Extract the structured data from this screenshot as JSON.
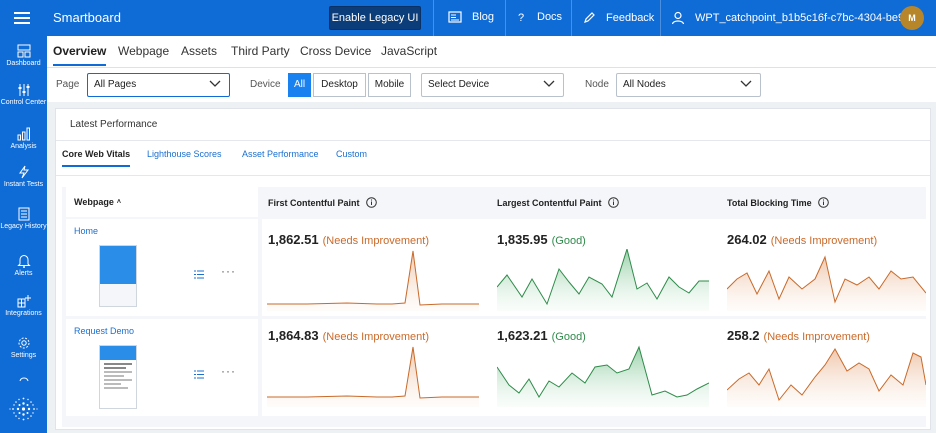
{
  "topbar": {
    "app_name": "Smartboard",
    "legacy_button": "Enable Legacy UI",
    "blog": "Blog",
    "docs": "Docs",
    "feedback": "Feedback",
    "user_id": "WPT_catchpoint_b1b5c16f-c7bc-4304-be9f...",
    "avatar_initial": "M"
  },
  "sidebar": {
    "items": [
      {
        "label": "Dashboard",
        "icon": "dashboard-icon"
      },
      {
        "label": "Control Center",
        "icon": "sliders-icon"
      },
      {
        "label": "Analysis",
        "icon": "bar-chart-icon"
      },
      {
        "label": "Instant Tests",
        "icon": "lightning-icon"
      },
      {
        "label": "Legacy History",
        "icon": "document-icon"
      },
      {
        "label": "Alerts",
        "icon": "bell-icon"
      },
      {
        "label": "Integrations",
        "icon": "integrations-icon"
      },
      {
        "label": "Settings",
        "icon": "gear-icon"
      }
    ]
  },
  "tabs": [
    "Overview",
    "Webpage",
    "Assets",
    "Third Party",
    "Cross Device",
    "JavaScript"
  ],
  "filters": {
    "page_label": "Page",
    "page_value": "All Pages",
    "device_label": "Device",
    "device_options": [
      "All",
      "Desktop",
      "Mobile"
    ],
    "device_select": "Select Device",
    "node_label": "Node",
    "node_value": "All Nodes"
  },
  "card": {
    "title": "Latest Performance",
    "subtabs": [
      "Core Web Vitals",
      "Lighthouse Scores",
      "Asset Performance",
      "Custom"
    ],
    "columns": {
      "webpage": "Webpage",
      "fcp": "First Contentful Paint",
      "lcp": "Largest Contentful Paint",
      "tbt": "Total Blocking Time"
    },
    "rows": [
      {
        "name": "Home",
        "fcp": {
          "value": "1,862.51",
          "status": "(Needs Improvement)"
        },
        "lcp": {
          "value": "1,835.95",
          "status": "(Good)"
        },
        "tbt": {
          "value": "264.02",
          "status": "(Needs Improvement)"
        }
      },
      {
        "name": "Request Demo",
        "fcp": {
          "value": "1,864.83",
          "status": "(Needs Improvement)"
        },
        "lcp": {
          "value": "1,623.21",
          "status": "(Good)"
        },
        "tbt": {
          "value": "258.2",
          "status": "(Needs Improvement)"
        }
      }
    ]
  },
  "colors": {
    "brand": "#0f6bd6",
    "needs_improvement": "#c96a2a",
    "good": "#2e8b4a"
  }
}
